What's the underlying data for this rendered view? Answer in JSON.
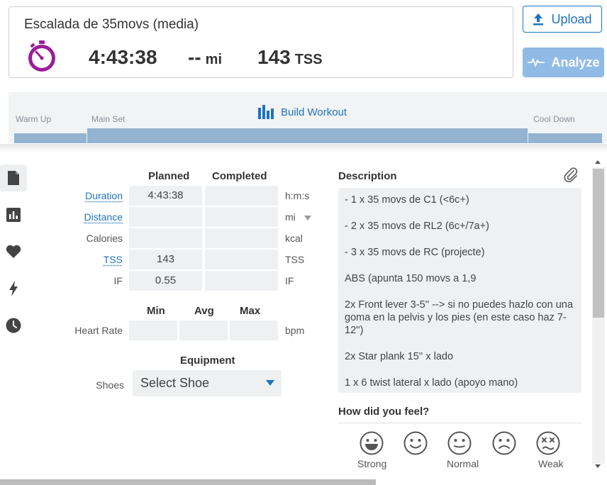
{
  "header": {
    "title": "Escalada de 35movs (media)",
    "duration": "4:43:38",
    "distance_value": "--",
    "distance_unit": "mi",
    "tss_value": "143",
    "tss_unit": "TSS",
    "upload_label": "Upload",
    "analyze_label": "Analyze",
    "stopwatch_color": "#9b1d9b"
  },
  "builder": {
    "warm_up": "Warm Up",
    "main_set": "Main Set",
    "build_label": "Build Workout",
    "cool_down": "Cool Down"
  },
  "side_tabs": [
    "document-icon",
    "chart-icon",
    "heart-icon",
    "lightning-icon",
    "clock-icon"
  ],
  "summary": {
    "planned_header": "Planned",
    "completed_header": "Completed",
    "rows": [
      {
        "label": "Duration",
        "planned": "4:43:38",
        "completed": "",
        "unit": "h:m:s"
      },
      {
        "label": "Distance",
        "planned": "",
        "completed": "",
        "unit": "mi"
      },
      {
        "label": "Calories",
        "planned": "",
        "completed": "",
        "unit": "kcal"
      },
      {
        "label": "TSS",
        "planned": "143",
        "completed": "",
        "unit": "TSS"
      },
      {
        "label": "IF",
        "planned": "0.55",
        "completed": "",
        "unit": "IF"
      }
    ],
    "hr": {
      "min_header": "Min",
      "avg_header": "Avg",
      "max_header": "Max",
      "label": "Heart Rate",
      "min": "",
      "avg": "",
      "max": "",
      "unit": "bpm"
    },
    "equipment_header": "Equipment",
    "shoes_label": "Shoes",
    "shoes_value": "Select Shoe"
  },
  "description": {
    "title": "Description",
    "lines": [
      "- 1 x 35 movs de C1 (<6c+)",
      "- 2 x 35 movs de RL2 (6c+/7a+)",
      "- 3 x 35 movs de RC (projecte)",
      "ABS (apunta 150 movs a 1,9",
      "2x Front lever 3-5'' --> si no puedes hazlo con una goma en la pelvis y los pies (en este caso haz 7-12'')",
      "2x Star plank 15'' x lado",
      "1 x 6 twist lateral x lado (apoyo mano)"
    ]
  },
  "feel": {
    "title": "How did you feel?",
    "labels": [
      "Strong",
      "",
      "Normal",
      "",
      "Weak"
    ]
  },
  "colors": {
    "accent": "#1e73be",
    "analyze_bg": "#8fbbe6",
    "bar": "#93b3d1"
  }
}
